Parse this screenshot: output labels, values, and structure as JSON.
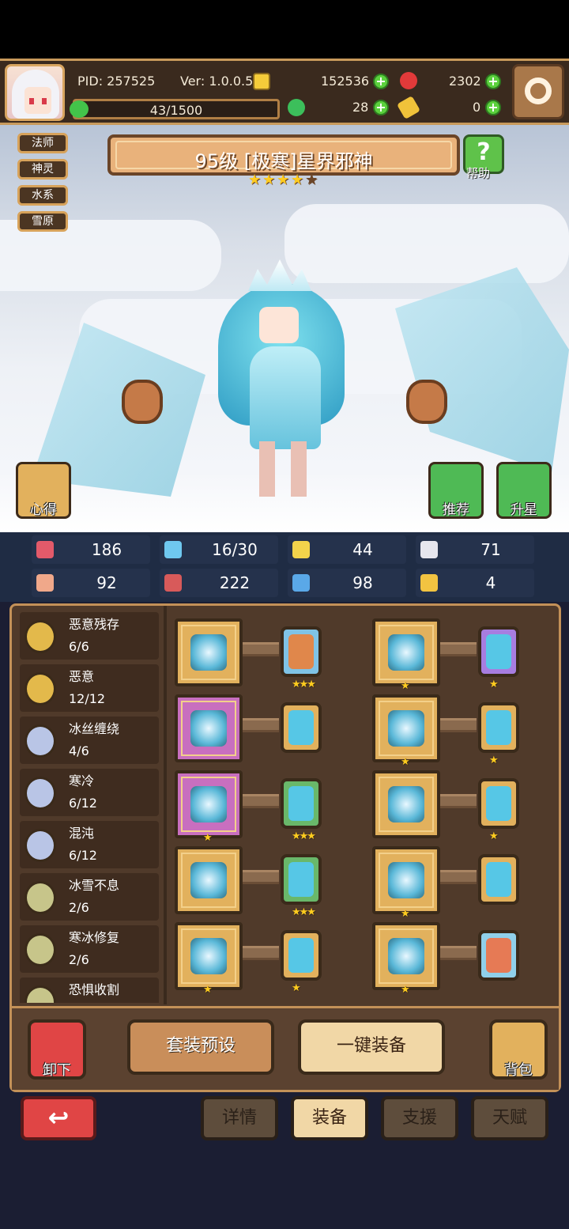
{
  "header": {
    "pid": "PID: 257525",
    "version": "Ver: 1.0.0.5",
    "gold": "152536",
    "gems": "2302",
    "stamina": "43/1500",
    "stamina_fraction": 0.029,
    "clover": "28",
    "keys": "0"
  },
  "tags": [
    "法师",
    "神灵",
    "水系",
    "雪原"
  ],
  "hero": {
    "title": "95级 [极寒]星界邪神",
    "stars": 4,
    "max_stars": 5,
    "help_label": "帮助",
    "notes_label": "心得",
    "recommend_label": "推荐",
    "upgrade_label": "升星"
  },
  "stats": [
    {
      "icon": "heart-icon",
      "value": "186",
      "color": "#e35a6a"
    },
    {
      "icon": "water-drop-icon",
      "value": "16/30",
      "color": "#6fc8ef"
    },
    {
      "icon": "shield-icon",
      "value": "44",
      "color": "#f2d34b"
    },
    {
      "icon": "wing-icon",
      "value": "71",
      "color": "#e6e6ee"
    },
    {
      "icon": "fist-icon",
      "value": "92",
      "color": "#f0a88a"
    },
    {
      "icon": "spellbook-icon",
      "value": "222",
      "color": "#d85a5a"
    },
    {
      "icon": "boot-icon",
      "value": "98",
      "color": "#5aa8e8"
    },
    {
      "icon": "horseshoe-icon",
      "value": "4",
      "color": "#f2c341"
    }
  ],
  "sets": [
    {
      "name": "恶意残存",
      "progress": "6/6",
      "color": "#e3b94b"
    },
    {
      "name": "恶意",
      "progress": "12/12",
      "color": "#e3b94b"
    },
    {
      "name": "冰丝缠绕",
      "progress": "4/6",
      "color": "#b9c5e6"
    },
    {
      "name": "寒冷",
      "progress": "6/12",
      "color": "#b9c5e6"
    },
    {
      "name": "混沌",
      "progress": "6/12",
      "color": "#b9c5e6"
    },
    {
      "name": "冰雪不息",
      "progress": "2/6",
      "color": "#c7c58a"
    },
    {
      "name": "寒冰修复",
      "progress": "2/6",
      "color": "#c7c58a"
    },
    {
      "name": "恐惧收割",
      "progress": "",
      "color": "#c7c58a"
    }
  ],
  "equipment": [
    {
      "slot_icon": "staff-icon",
      "slot_color": "#e2b15d",
      "slot_stars": "",
      "gem_icon": "orange-rune-gem-icon",
      "gem_color": "#e0874b",
      "gem_frame": "#7fc3e6",
      "gem_stars": "★★★"
    },
    {
      "slot_icon": "ice-crown-icon",
      "slot_color": "#e2b15d",
      "slot_stars": "★",
      "gem_icon": "blue-gem-icon",
      "gem_color": "#56c7e6",
      "gem_frame": "#a77de0",
      "gem_stars": "★"
    },
    {
      "slot_icon": "lotus-orb-icon",
      "slot_color": "#c86fbf",
      "slot_stars": "",
      "gem_icon": "blue-gem-icon",
      "gem_color": "#56c7e6",
      "gem_frame": "#e2b15d",
      "gem_stars": ""
    },
    {
      "slot_icon": "ice-robe-icon",
      "slot_color": "#e2b15d",
      "slot_stars": "★",
      "gem_icon": "blue-gem-icon",
      "gem_color": "#56c7e6",
      "gem_frame": "#e2b15d",
      "gem_stars": "★"
    },
    {
      "slot_icon": "necklace-icon",
      "slot_color": "#c86fbf",
      "slot_stars": "★",
      "gem_icon": "blue-gem-icon",
      "gem_color": "#56c7e6",
      "gem_frame": "#69b86a",
      "gem_stars": "★★★"
    },
    {
      "slot_icon": "ice-gauntlet-icon",
      "slot_color": "#e2b15d",
      "slot_stars": "",
      "gem_icon": "blue-gem-icon",
      "gem_color": "#56c7e6",
      "gem_frame": "#e2b15d",
      "gem_stars": "★"
    },
    {
      "slot_icon": "dark-orb-icon",
      "slot_color": "#e2b15d",
      "slot_stars": "",
      "gem_icon": "blue-gem-icon",
      "gem_color": "#56c7e6",
      "gem_frame": "#69b86a",
      "gem_stars": "★★★"
    },
    {
      "slot_icon": "ice-belt-icon",
      "slot_color": "#e2b15d",
      "slot_stars": "★",
      "gem_icon": "blue-gem-icon",
      "gem_color": "#56c7e6",
      "gem_frame": "#e2b15d",
      "gem_stars": ""
    },
    {
      "slot_icon": "ice-ring-icon",
      "slot_color": "#e2b15d",
      "slot_stars": "★",
      "gem_icon": "blue-gem-icon",
      "gem_color": "#56c7e6",
      "gem_frame": "#e2b15d",
      "gem_stars": "★"
    },
    {
      "slot_icon": "boots-icon",
      "slot_color": "#e2b15d",
      "slot_stars": "★",
      "gem_icon": "eye-card-icon",
      "gem_color": "#e67a55",
      "gem_frame": "#8fd0ea",
      "gem_stars": ""
    }
  ],
  "actions": {
    "unequip": "卸下",
    "preset": "套装预设",
    "auto_equip": "一键装备",
    "backpack": "背包"
  },
  "tabs": [
    "详情",
    "装备",
    "支援",
    "天赋"
  ],
  "active_tab": "装备"
}
